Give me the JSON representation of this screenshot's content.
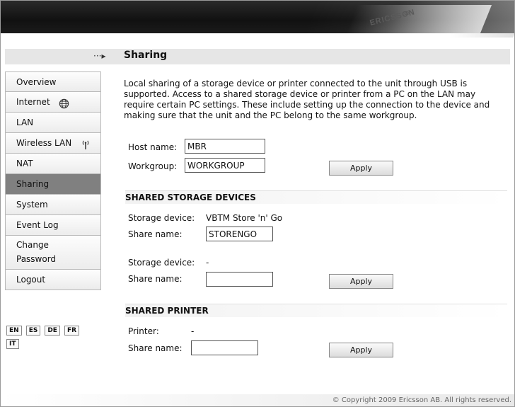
{
  "header": {
    "brand": "ERICSSON"
  },
  "page": {
    "title": "Sharing",
    "crumb_arrow": "···▸"
  },
  "sidebar": {
    "items": [
      {
        "label": "Overview"
      },
      {
        "label": "Internet"
      },
      {
        "label": "LAN"
      },
      {
        "label": "Wireless LAN"
      },
      {
        "label": "NAT"
      },
      {
        "label": "Sharing",
        "active": true
      },
      {
        "label": "System"
      },
      {
        "label": "Event Log"
      },
      {
        "label": "Change\nPassword"
      },
      {
        "label": "Logout"
      }
    ],
    "icons": {
      "internet": "globe-icon",
      "wireless": "antenna-icon"
    }
  },
  "languages": [
    "EN",
    "ES",
    "DE",
    "FR",
    "IT"
  ],
  "intro": "Local sharing of a storage device or printer connected to the unit through USB is supported. Access to a shared storage device or printer from a PC on the LAN may require certain PC settings. These include setting up the connection to the device and making sure that the unit and the PC belong to the same workgroup.",
  "general": {
    "host_label": "Host name:",
    "host_value": "MBR",
    "workgroup_label": "Workgroup:",
    "workgroup_value": "WORKGROUP",
    "apply": "Apply"
  },
  "storage": {
    "heading": "SHARED STORAGE DEVICES",
    "device1_label": "Storage device:",
    "device1_value": "VBTM Store 'n' Go",
    "share1_label": "Share name:",
    "share1_value": "STORENGO",
    "device2_label": "Storage device:",
    "device2_value": "-",
    "share2_label": "Share name:",
    "share2_value": "",
    "apply": "Apply"
  },
  "printer": {
    "heading": "SHARED PRINTER",
    "printer_label": "Printer:",
    "printer_value": "-",
    "share_label": "Share name:",
    "share_value": "",
    "apply": "Apply"
  },
  "footer": {
    "copyright": "© Copyright 2009 Ericsson AB. All rights reserved."
  }
}
